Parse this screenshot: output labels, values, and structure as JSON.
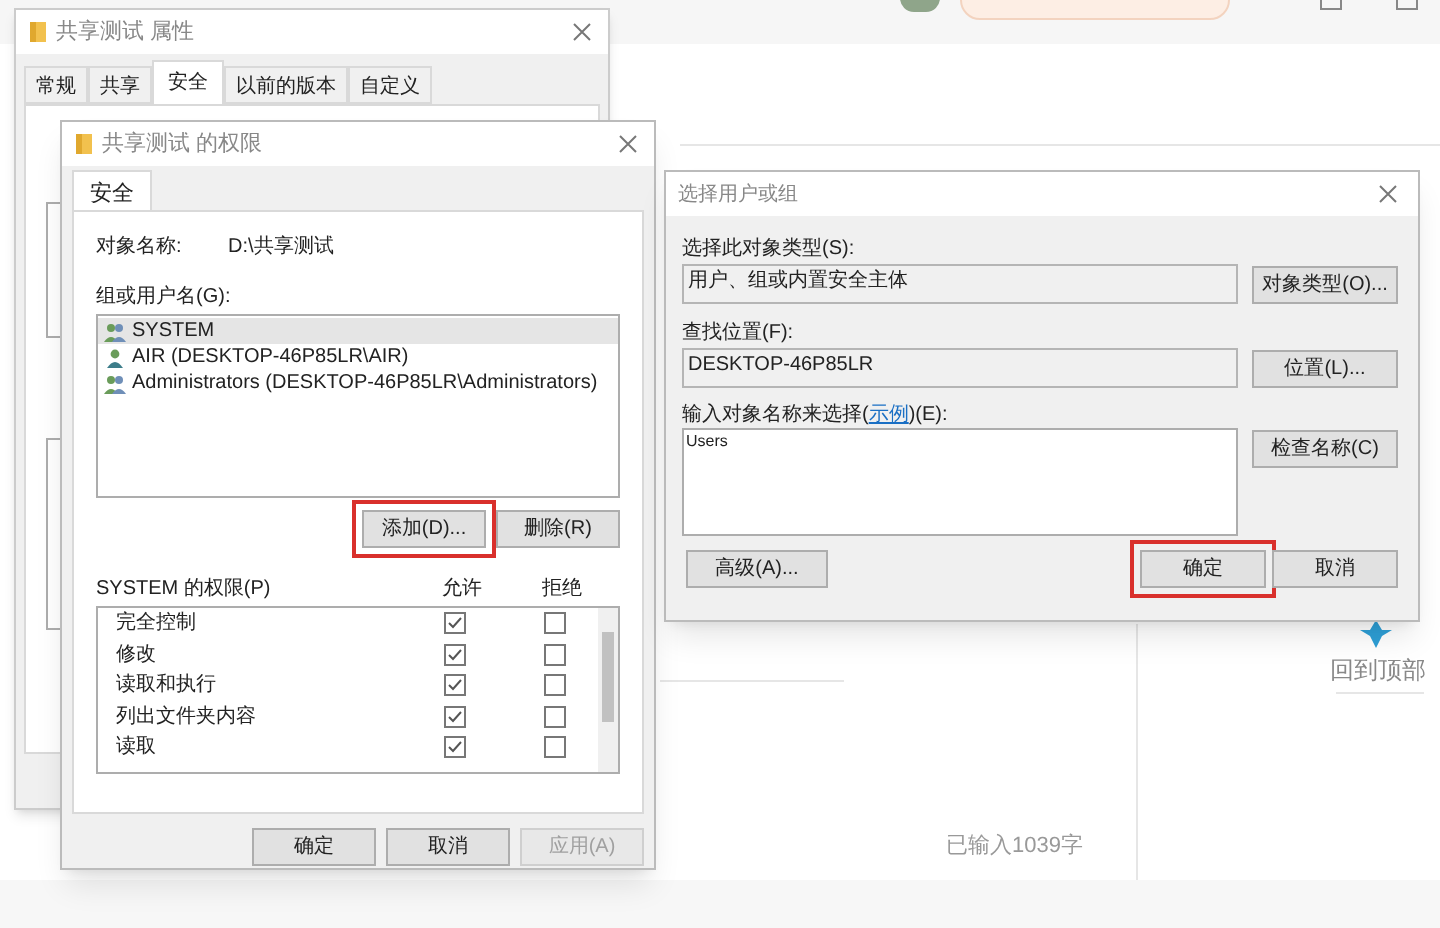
{
  "page": {
    "back_to_top": "回到顶部",
    "char_count": "已输入1039字"
  },
  "properties_window": {
    "title": "共享测试 属性",
    "tabs": [
      {
        "label": "常规",
        "selected": false
      },
      {
        "label": "共享",
        "selected": false
      },
      {
        "label": "安全",
        "selected": true
      },
      {
        "label": "以前的版本",
        "selected": false
      },
      {
        "label": "自定义",
        "selected": false
      }
    ]
  },
  "permissions_window": {
    "title": "共享测试 的权限",
    "tabs": [
      {
        "label": "安全",
        "selected": true
      }
    ],
    "object_name_label": "对象名称:",
    "object_name": "D:\\共享测试",
    "group_label": "组或用户名(G):",
    "users": [
      {
        "name": "SYSTEM",
        "kind": "group",
        "selected": true
      },
      {
        "name": "AIR (DESKTOP-46P85LR\\AIR)",
        "kind": "user",
        "selected": false
      },
      {
        "name": "Administrators (DESKTOP-46P85LR\\Administrators)",
        "kind": "group",
        "selected": false
      }
    ],
    "list_buttons": [
      {
        "label": "添加(D)...",
        "highlighted": true
      },
      {
        "label": "删除(R)",
        "highlighted": false
      }
    ],
    "permissions_label": "SYSTEM 的权限(P)",
    "columns": [
      "允许",
      "拒绝"
    ],
    "permissions": [
      {
        "name": "完全控制",
        "allow": true,
        "deny": false
      },
      {
        "name": "修改",
        "allow": true,
        "deny": false
      },
      {
        "name": "读取和执行",
        "allow": true,
        "deny": false
      },
      {
        "name": "列出文件夹内容",
        "allow": true,
        "deny": false
      },
      {
        "name": "读取",
        "allow": true,
        "deny": false
      }
    ],
    "buttons": [
      {
        "label": "确定",
        "disabled": false
      },
      {
        "label": "取消",
        "disabled": false
      },
      {
        "label": "应用(A)",
        "disabled": true
      }
    ]
  },
  "select_dialog": {
    "title": "选择用户或组",
    "type_label": "选择此对象类型(S):",
    "type_value": "用户、组或内置安全主体",
    "type_button": "对象类型(O)...",
    "location_label": "查找位置(F):",
    "location_value": "DESKTOP-46P85LR",
    "location_button": "位置(L)...",
    "names_label_before": "输入对象名称来选择(",
    "names_link": "示例",
    "names_label_after": ")(E):",
    "names_value": "Users",
    "check_button": "检查名称(C)",
    "buttons": [
      {
        "label": "高级(A)...",
        "highlighted": false
      },
      {
        "label": "确定",
        "highlighted": true
      },
      {
        "label": "取消",
        "highlighted": false
      }
    ]
  }
}
